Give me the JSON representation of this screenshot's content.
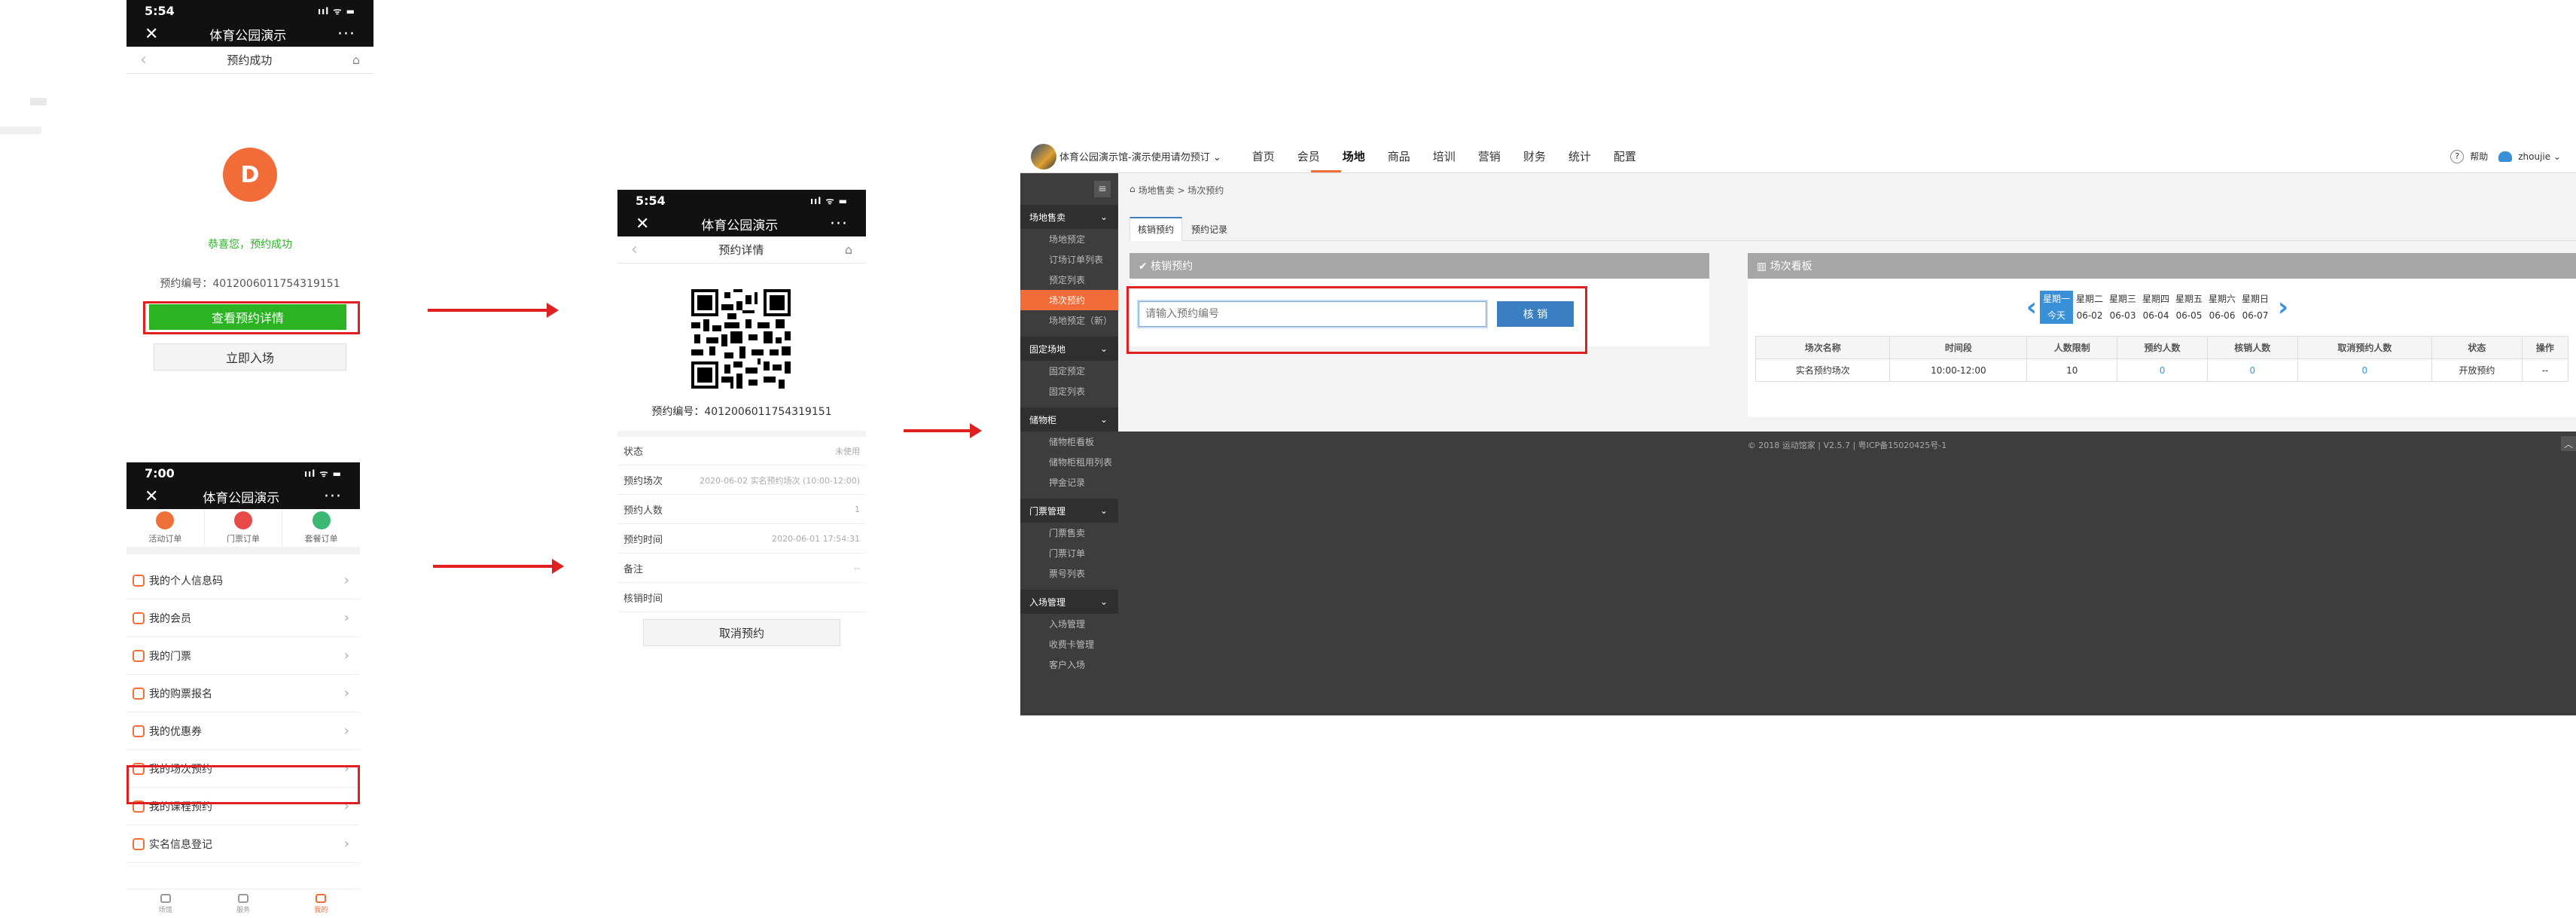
{
  "phone1": {
    "status_time": "5:54",
    "signal": "ııl ᯤ ▬",
    "nav_title": "体育公园演示",
    "nav_close": "✕",
    "nav_more": "···",
    "sub_title": "预约成功",
    "back_glyph": "‹",
    "home_glyph": "⌂",
    "logo_glyph": "D",
    "success_text": "恭喜您，预约成功",
    "order_label": "预约编号：",
    "order_no": "40120060117543191​51",
    "detail_button": "查看预约详情",
    "enter_button": "立即入场"
  },
  "phone2": {
    "status_time": "7:00",
    "signal": "ııl ᯤ ▬",
    "nav_title": "体育公园演示",
    "nav_close": "✕",
    "nav_more": "···",
    "tabs": [
      {
        "label": "活动订单",
        "color": "#f0703a"
      },
      {
        "label": "门票订单",
        "color": "#e84a4a"
      },
      {
        "label": "套餐订单",
        "color": "#3bb873"
      }
    ],
    "menu": [
      {
        "label": "我的个人信息码"
      },
      {
        "label": "我的会员"
      },
      {
        "label": "我的门票"
      },
      {
        "label": "我的购票报名"
      },
      {
        "label": "我的优惠券"
      },
      {
        "label": "我的场次预约"
      },
      {
        "label": "我的课程预约"
      },
      {
        "label": "实名信息登记"
      }
    ],
    "chevron": "›",
    "bottom": [
      {
        "label": "场馆"
      },
      {
        "label": "服务"
      },
      {
        "label": "我的"
      }
    ]
  },
  "phone3": {
    "status_time": "5:54",
    "signal": "ııl ᯤ ▬",
    "nav_title": "体育公园演示",
    "nav_close": "✕",
    "nav_more": "···",
    "sub_title": "预约详情",
    "back_glyph": "‹",
    "home_glyph": "⌂",
    "order_label": "预约编号：",
    "order_no": "4012006011754319151",
    "rows": [
      {
        "k": "状态",
        "v": "未使用"
      },
      {
        "k": "预约场次",
        "v": "2020-06-02 实名预约场次 (10:00-12:00)"
      },
      {
        "k": "预约人数",
        "v": "1"
      },
      {
        "k": "预约时间",
        "v": "2020-06-01 17:54:31"
      },
      {
        "k": "备注",
        "v": "--"
      },
      {
        "k": "核销时间",
        "v": ""
      }
    ],
    "cancel_button": "取消预约"
  },
  "admin": {
    "brand": "体育公园演示馆-演示使用请勿预订 ⌄",
    "nav": [
      "首页",
      "会员",
      "场地",
      "商品",
      "培训",
      "营销",
      "财务",
      "统计",
      "配置"
    ],
    "active_nav": "场地",
    "help": "帮助",
    "user": "zhoujie ⌄",
    "help_icon": "?",
    "collapse_icon": "≡",
    "breadcrumb_home": "⌂",
    "breadcrumb": "场地售卖 > 场次预约",
    "tabs": [
      "核销预约",
      "预约记录"
    ],
    "sidebar": [
      {
        "group": "场地售卖",
        "items": [
          "场地预定",
          "订场订单列表",
          "预定列表",
          "场次预约",
          "场地预定（新）"
        ],
        "active": "场次预约"
      },
      {
        "group": "固定场地",
        "items": [
          "固定预定",
          "固定列表"
        ]
      },
      {
        "group": "储物柜",
        "items": [
          "储物柜看板",
          "储物柜租用列表",
          "押金记录"
        ]
      },
      {
        "group": "门票管理",
        "items": [
          "门票售卖",
          "门票订单",
          "票号列表"
        ]
      },
      {
        "group": "入场管理",
        "items": [
          "入场管理",
          "收费卡管理",
          "客户入场"
        ]
      }
    ],
    "group_chevron": "⌄",
    "verify_panel_title": "✔ 核销预约",
    "verify_placeholder": "请输入预约编号",
    "verify_button": "核 销",
    "board_title": "▥ 场次看板",
    "week": [
      {
        "day": "星期一",
        "date": "今天",
        "active": true
      },
      {
        "day": "星期二",
        "date": "06-02"
      },
      {
        "day": "星期三",
        "date": "06-03"
      },
      {
        "day": "星期四",
        "date": "06-04"
      },
      {
        "day": "星期五",
        "date": "06-05"
      },
      {
        "day": "星期六",
        "date": "06-06"
      },
      {
        "day": "星期日",
        "date": "06-07"
      }
    ],
    "prev": "‹",
    "next": "›",
    "table_headers": [
      "场次名称",
      "时间段",
      "人数限制",
      "预约人数",
      "核销人数",
      "取消预约人数",
      "状态",
      "操作"
    ],
    "table_rows": [
      [
        "实名预约场次",
        "10:00-12:00",
        "10",
        "0",
        "0",
        "0",
        "开放预约",
        "--"
      ]
    ],
    "footer": "© 2018 运动馆家 | V2.5.7 | 粤ICP备15020425号-1",
    "scroll_top": "︿"
  },
  "colors": {
    "accent": "#f26c3a",
    "green": "#2bb324",
    "red": "#e02020",
    "blue": "#3a7fc1",
    "link": "#3399dd"
  }
}
